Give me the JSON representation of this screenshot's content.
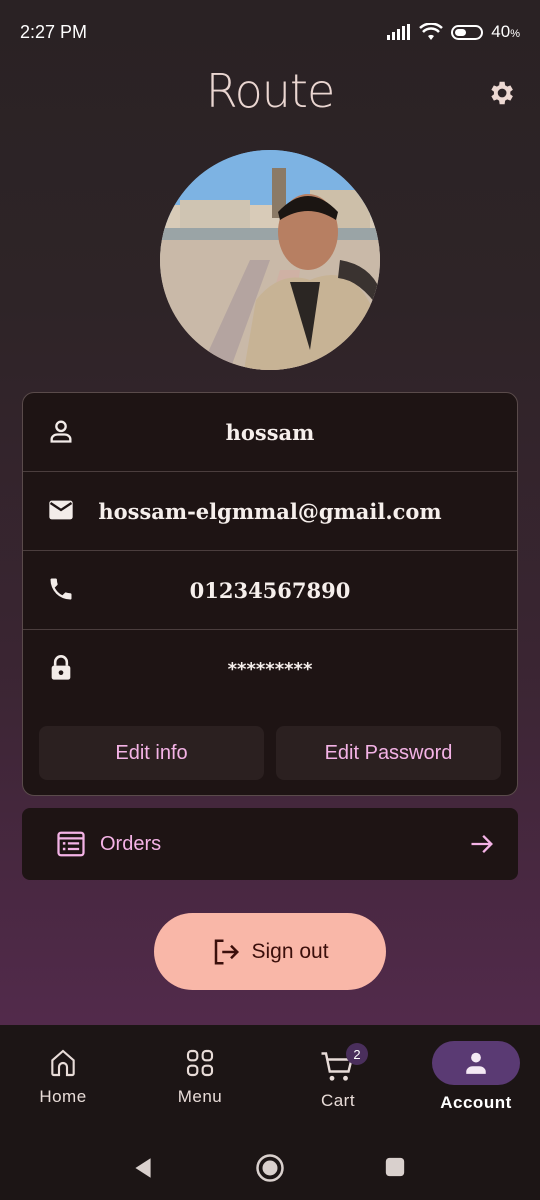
{
  "status_bar": {
    "time": "2:27 PM",
    "battery": "40"
  },
  "header": {
    "logo": "Route",
    "settings_icon": "gear-icon"
  },
  "profile": {
    "name": "hossam",
    "email": "hossam-elgmmal@gmail.com",
    "phone": "01234567890",
    "password": "*********"
  },
  "actions": {
    "edit_info": "Edit info",
    "edit_password": "Edit Password"
  },
  "orders": {
    "label": "Orders"
  },
  "signout": {
    "label": "Sign out"
  },
  "nav": {
    "items": [
      {
        "label": "Home",
        "icon": "home-icon"
      },
      {
        "label": "Menu",
        "icon": "grid-icon"
      },
      {
        "label": "Cart",
        "icon": "cart-icon",
        "badge": "2"
      },
      {
        "label": "Account",
        "icon": "person-icon",
        "active": true
      }
    ]
  },
  "colors": {
    "accent": "#f4b3e6",
    "signout_bg": "#f9b7a8",
    "active_nav": "#5a3a73",
    "card_bg": "#1e1414"
  }
}
